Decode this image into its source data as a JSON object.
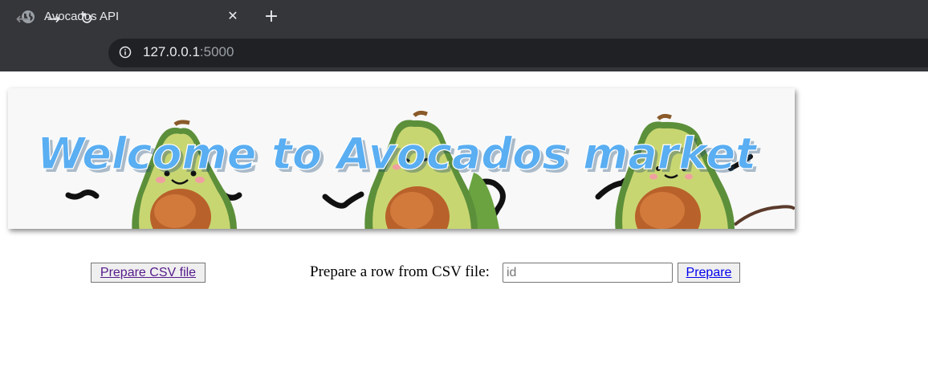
{
  "browser": {
    "tab_title": "Avocados API",
    "tab_close": "✕",
    "new_tab": "+",
    "url_host": "127.0.0.1",
    "url_port": ":5000",
    "back": "←",
    "forward": "→",
    "reload": "↻"
  },
  "banner": {
    "text": "Welcome to Avocados market",
    "text_color": "#5aaef2"
  },
  "page": {
    "prepare_csv_label": "Prepare CSV file",
    "row_label": "Prepare a row from CSV file:",
    "id_placeholder": "id",
    "id_value": "",
    "prepare_label": "Prepare"
  }
}
